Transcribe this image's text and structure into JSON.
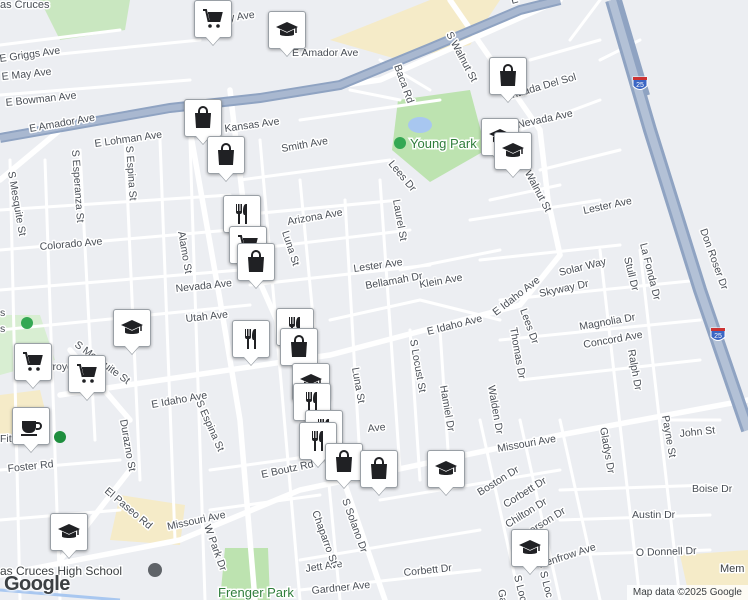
{
  "streets": [
    {
      "id": "e-amador-ave-1",
      "text": "E Amador Ave"
    },
    {
      "id": "e-amador-ave-2",
      "text": "E Amador Ave"
    },
    {
      "id": "e-griggs-ave",
      "text": "E Griggs Ave"
    },
    {
      "id": "e-may-ave",
      "text": "E May Ave"
    },
    {
      "id": "e-bowman-ave",
      "text": "E Bowman Ave"
    },
    {
      "id": "e-lohman-ave",
      "text": "E Lohman Ave"
    },
    {
      "id": "kansas-ave",
      "text": "Kansas Ave"
    },
    {
      "id": "smith-ave",
      "text": "Smith Ave"
    },
    {
      "id": "arizona-ave",
      "text": "Arizona Ave"
    },
    {
      "id": "colorado-ave",
      "text": "Colorado Ave"
    },
    {
      "id": "nevada-ave",
      "text": "Nevada Ave"
    },
    {
      "id": "utah-ave",
      "text": "Utah Ave"
    },
    {
      "id": "lester-ave-1",
      "text": "Lester Ave"
    },
    {
      "id": "lester-ave-2",
      "text": "Lester Ave"
    },
    {
      "id": "bellamah-dr",
      "text": "Bellamah Dr"
    },
    {
      "id": "klein-ave",
      "text": "Klein Ave"
    },
    {
      "id": "e-idaho-ave-1",
      "text": "E Idaho Ave"
    },
    {
      "id": "e-idaho-ave-2",
      "text": "E Idaho Ave"
    },
    {
      "id": "e-idaho-ave-3",
      "text": "E Idaho Ave"
    },
    {
      "id": "solar-way",
      "text": "Solar Way"
    },
    {
      "id": "skyway-dr",
      "text": "Skyway Dr"
    },
    {
      "id": "magnolia-dr",
      "text": "Magnolia Dr"
    },
    {
      "id": "concord-ave",
      "text": "Concord Ave"
    },
    {
      "id": "missouri-ave-1",
      "text": "Missouri Ave"
    },
    {
      "id": "missouri-ave-2",
      "text": "Missouri Ave"
    },
    {
      "id": "john-st",
      "text": "John St"
    },
    {
      "id": "boise-dr",
      "text": "Boise Dr"
    },
    {
      "id": "austin-dr",
      "text": "Austin Dr"
    },
    {
      "id": "o-donnell-dr",
      "text": "O Donnell Dr"
    },
    {
      "id": "e-boutz-rd",
      "text": "E Boutz Rd"
    },
    {
      "id": "foster-rd",
      "text": "Foster Rd"
    },
    {
      "id": "el-paseo-rd",
      "text": "El Paseo Rd"
    },
    {
      "id": "jett-ave",
      "text": "Jett Ave"
    },
    {
      "id": "gardner-ave",
      "text": "Gardner Ave"
    },
    {
      "id": "corbett-dr-1",
      "text": "Corbett Dr"
    },
    {
      "id": "corbett-dr-2",
      "text": "Corbett Dr"
    },
    {
      "id": "boston-dr",
      "text": "Boston Dr"
    },
    {
      "id": "chilton-dr",
      "text": "Chilton Dr"
    },
    {
      "id": "renfrow-ave",
      "text": "Renfrow Ave"
    },
    {
      "id": "baca-rd",
      "text": "Baca Rd"
    },
    {
      "id": "lees-dr-1",
      "text": "Lees Dr"
    },
    {
      "id": "lees-dr-2",
      "text": "Lees Dr"
    },
    {
      "id": "laurel-st",
      "text": "Laurel St"
    },
    {
      "id": "luna-st-1",
      "text": "Luna St"
    },
    {
      "id": "luna-st-2",
      "text": "Luna St"
    },
    {
      "id": "s-walnut-st-1",
      "text": "S Walnut St"
    },
    {
      "id": "s-walnut-st-2",
      "text": "S Walnut St"
    },
    {
      "id": "entrada-del-sol",
      "text": "Entrada Del Sol"
    },
    {
      "id": "nevada-ave-2",
      "text": "Nevada Ave"
    },
    {
      "id": "don-roser-dr",
      "text": "Don Roser Dr"
    },
    {
      "id": "la-fonda-dr",
      "text": "La Fonda Dr"
    },
    {
      "id": "stull-dr",
      "text": "Stull Dr"
    },
    {
      "id": "thomas-dr",
      "text": "Thomas Dr"
    },
    {
      "id": "ralph-dr",
      "text": "Ralph Dr"
    },
    {
      "id": "gladys-dr",
      "text": "Gladys Dr"
    },
    {
      "id": "payne-st",
      "text": "Payne St"
    },
    {
      "id": "walden-dr",
      "text": "Walden Dr"
    },
    {
      "id": "hamiel-dr",
      "text": "Hamiel Dr"
    },
    {
      "id": "s-locust-st-1",
      "text": "S Locust St"
    },
    {
      "id": "s-locust-st-2",
      "text": "S Locust St"
    },
    {
      "id": "s-solano-dr",
      "text": "S Solano Dr"
    },
    {
      "id": "chaparro-st",
      "text": "Chaparro St"
    },
    {
      "id": "w-park-dr",
      "text": "W Park Dr"
    },
    {
      "id": "s-espina-st-1",
      "text": "S Espina St"
    },
    {
      "id": "s-espina-st-2",
      "text": "S Espina St"
    },
    {
      "id": "s-esperanza-st",
      "text": "S Esperanza St"
    },
    {
      "id": "s-mesquite-st-1",
      "text": "S Mesquite St"
    },
    {
      "id": "s-mesquite-st-2",
      "text": "S Mesquite St"
    },
    {
      "id": "alamo-st",
      "text": "Alamo St"
    },
    {
      "id": "durazno-st",
      "text": "Durazno St"
    },
    {
      "id": "ray-ave",
      "text": "ay Ave"
    },
    {
      "id": "ave-partial",
      "text": "Ave"
    },
    {
      "id": "erson-dr",
      "text": "erson Dr"
    },
    {
      "id": "gar-partial",
      "text": "Gar"
    },
    {
      "id": "s-loc-partial",
      "text": "S Loc"
    },
    {
      "id": "e-partial",
      "text": "E"
    }
  ],
  "places": {
    "young_park": "Young Park",
    "frenger_park": "Frenger Park",
    "high_school": "as Cruces High School",
    "city_partial": "as Cruces",
    "arroyo_partial": "Arroyo",
    "fit_partial": "Fit",
    "s_partial": "s",
    "s_partial2": "s",
    "mem_partial": "Mem"
  },
  "highway": {
    "shield": "25"
  },
  "footer": {
    "logo": "Google",
    "attribution": "Map data ©2025 Google"
  },
  "markers": [
    {
      "type": "shopping-cart"
    },
    {
      "type": "school"
    },
    {
      "type": "shopping-bag"
    },
    {
      "type": "shopping-bag"
    },
    {
      "type": "school"
    },
    {
      "type": "school"
    },
    {
      "type": "shopping-bag"
    },
    {
      "type": "restaurant"
    },
    {
      "type": "shopping-cart"
    },
    {
      "type": "shopping-bag"
    },
    {
      "type": "school"
    },
    {
      "type": "restaurant"
    },
    {
      "type": "restaurant"
    },
    {
      "type": "shopping-bag"
    },
    {
      "type": "shopping-cart"
    },
    {
      "type": "shopping-cart"
    },
    {
      "type": "cafe"
    },
    {
      "type": "school"
    },
    {
      "type": "restaurant"
    },
    {
      "type": "restaurant"
    },
    {
      "type": "restaurant"
    },
    {
      "type": "shopping-bag"
    },
    {
      "type": "shopping-bag"
    },
    {
      "type": "school"
    },
    {
      "type": "school"
    },
    {
      "type": "school"
    }
  ],
  "colors": {
    "water": "#a8c7f0",
    "park": "#bde3b0",
    "highway": "#8fa3c2",
    "freeway": "#9aa9bf",
    "road": "#ffffff",
    "sand": "#f5ebc8"
  }
}
